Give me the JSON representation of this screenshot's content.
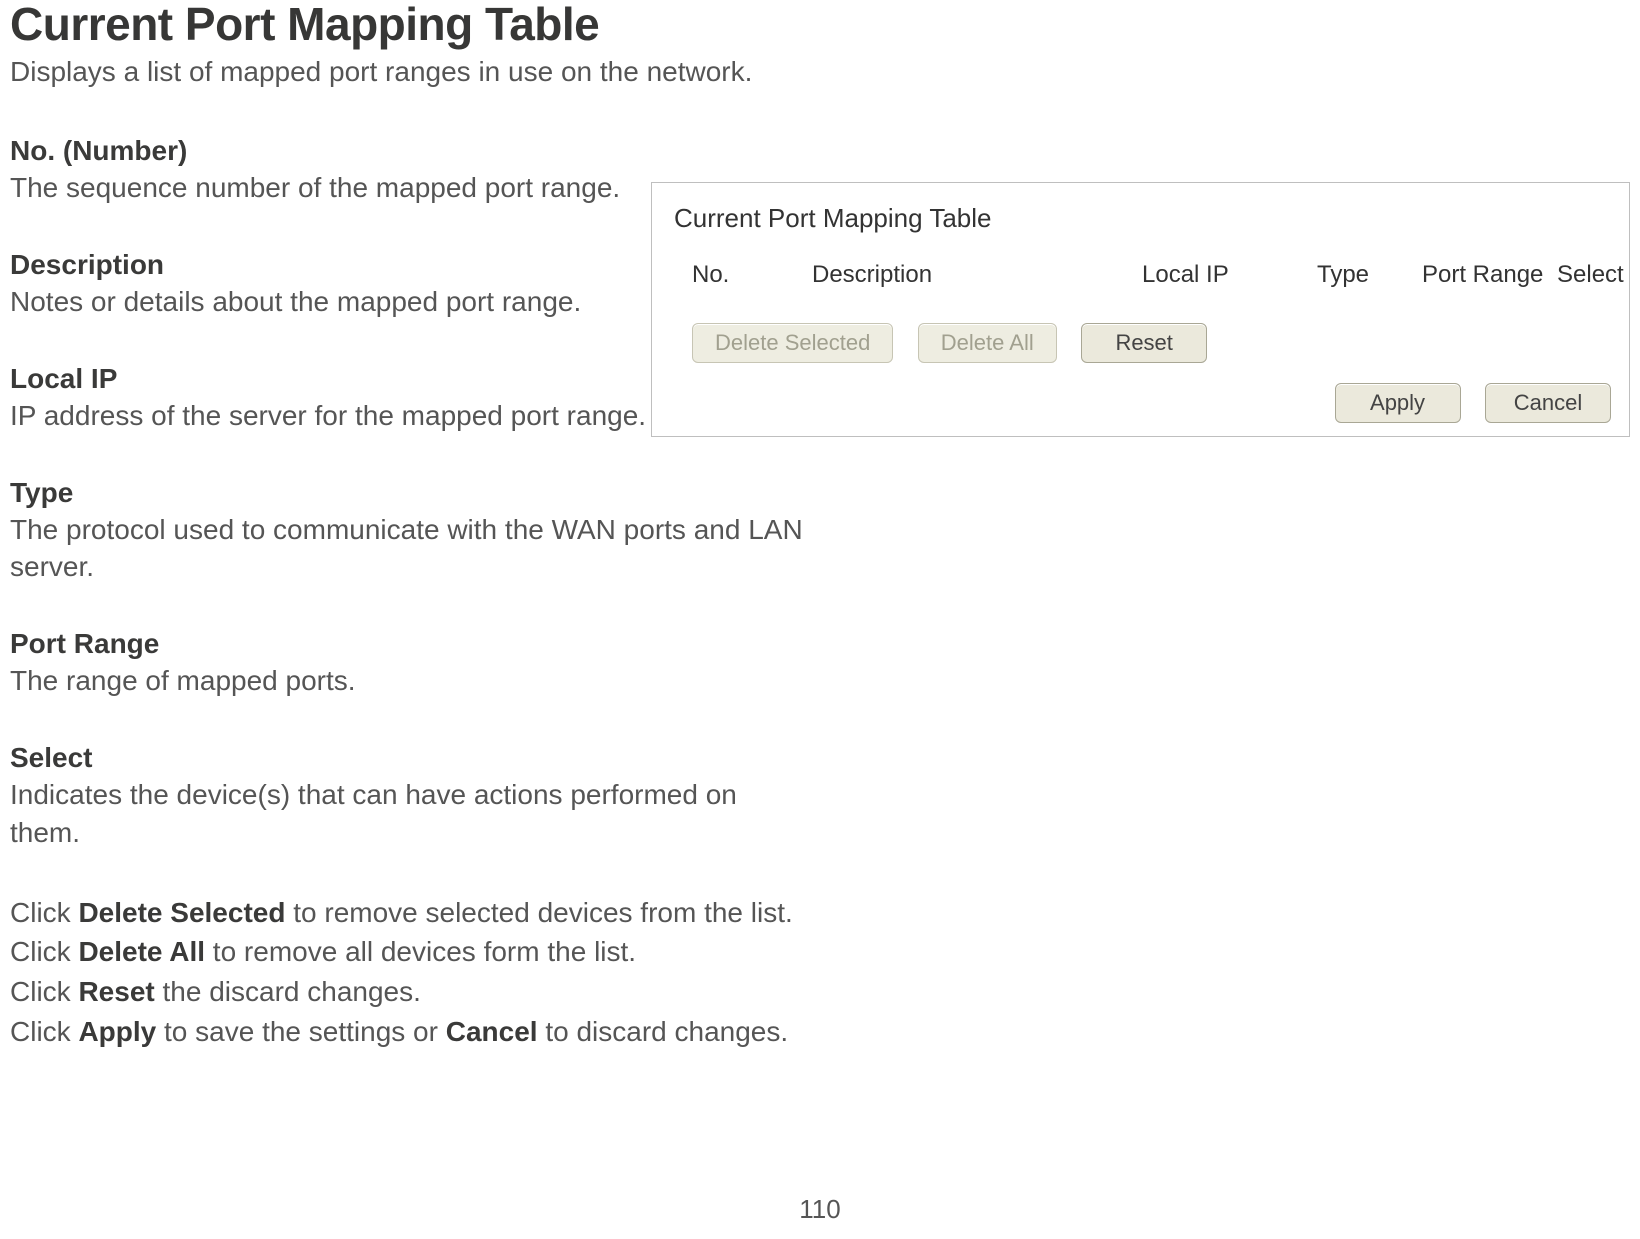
{
  "heading": "Current Port Mapping Table",
  "subtitle": "Displays a list of mapped port ranges in use on the network.",
  "fields": {
    "no": {
      "label": "No. (Number)",
      "desc": "The sequence number of the mapped port range."
    },
    "desc": {
      "label": "Description",
      "desc": "Notes or details about the mapped port range."
    },
    "localip": {
      "label": "Local IP",
      "desc": "IP address of the server for the mapped port range."
    },
    "type": {
      "label": "Type",
      "desc": "The protocol used to communicate with the WAN ports and LAN server."
    },
    "portrange": {
      "label": "Port Range",
      "desc": "The range of mapped ports."
    },
    "select": {
      "label": "Select",
      "desc": "Indicates the device(s) that can have actions performed on them."
    }
  },
  "actions": {
    "line1a": "Click ",
    "line1b": "Delete Selected",
    "line1c": " to remove selected devices from the list.",
    "line2a": "Click ",
    "line2b": "Delete All",
    "line2c": " to remove all devices form the list.",
    "line3a": "Click ",
    "line3b": "Reset",
    "line3c": " the discard changes.",
    "line4a": "Click ",
    "line4b": "Apply",
    "line4c": " to save the settings or ",
    "line4d": "Cancel",
    "line4e": " to discard changes."
  },
  "panel": {
    "title": "Current Port Mapping Table",
    "headers": {
      "no": "No.",
      "desc": "Description",
      "localip": "Local IP",
      "type": "Type",
      "portrange": "Port Range",
      "select": "Select"
    },
    "buttons": {
      "delsel": "Delete Selected",
      "delall": "Delete All",
      "reset": "Reset",
      "apply": "Apply",
      "cancel": "Cancel"
    }
  },
  "page_number": "110"
}
